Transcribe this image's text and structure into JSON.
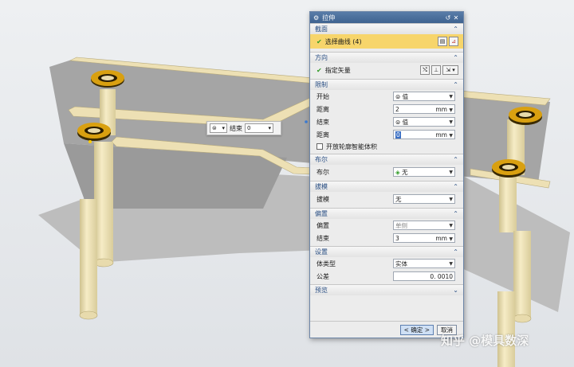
{
  "dialog": {
    "title": "拉伸",
    "sections": {
      "section_profile": {
        "title": "截面",
        "select_curve_label": "选择曲线 (4)"
      },
      "direction": {
        "title": "方向",
        "specify_vector_label": "指定矢量"
      },
      "limits": {
        "title": "限制",
        "start_label": "开始",
        "start_value": "值",
        "distance1_label": "距离",
        "distance1_value": "2",
        "distance1_unit": "mm",
        "end_label": "结束",
        "end_value": "值",
        "distance2_label": "距离",
        "distance2_value": "0",
        "distance2_unit": "mm",
        "open_profile_label": "开放轮廓智能体积"
      },
      "boolean": {
        "title": "布尔",
        "boolean_label": "布尔",
        "boolean_value": "无"
      },
      "draft": {
        "title": "拔模",
        "draft_label": "拔模",
        "draft_value": "无"
      },
      "offset": {
        "title": "偏置",
        "offset_label": "偏置",
        "offset_value": "单侧",
        "end_label": "结束",
        "end_value": "3",
        "end_unit": "mm"
      },
      "settings": {
        "title": "设置",
        "body_type_label": "体类型",
        "body_type_value": "实体",
        "tolerance_label": "公差",
        "tolerance_value": "0. 0010"
      },
      "preview": {
        "title": "预览"
      }
    },
    "buttons": {
      "ok": "< 确定 >",
      "cancel": "取消"
    }
  },
  "mini_toolbar": {
    "end_label": "结束",
    "end_value": "0"
  },
  "watermark": "知乎 @模具数深",
  "colors": {
    "model_beige": "#ede0b4",
    "plate_gray": "#a4a4a4",
    "title_blue": "#4a6d9a",
    "highlight_yellow": "#f7d56b"
  }
}
